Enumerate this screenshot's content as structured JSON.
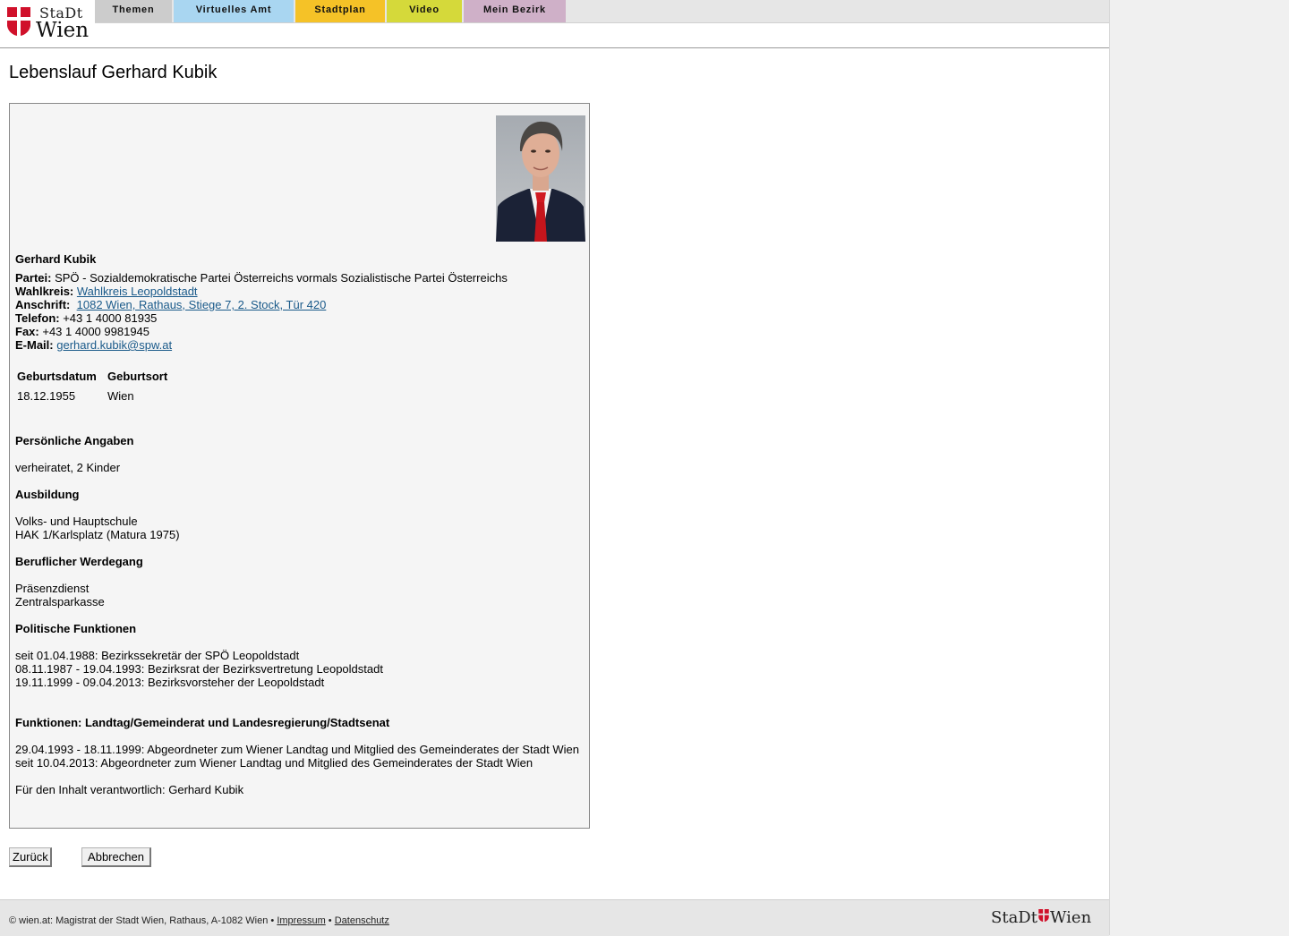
{
  "header": {
    "logo_line1": "StaDt",
    "logo_line2": "Wien",
    "nav": [
      {
        "label": "Themen",
        "color": "#cccccc"
      },
      {
        "label": "Virtuelles Amt",
        "color": "#a9d6f1"
      },
      {
        "label": "Stadtplan",
        "color": "#f5c227"
      },
      {
        "label": "Video",
        "color": "#d5d93a"
      },
      {
        "label": "Mein Bezirk",
        "color": "#cfb0c8"
      }
    ]
  },
  "page": {
    "title": "Lebenslauf Gerhard Kubik"
  },
  "profile": {
    "name": "Gerhard Kubik",
    "party_label": "Partei:",
    "party": "SPÖ - Sozialdemokratische Partei Österreichs vormals Sozialistische Partei Österreichs",
    "district_label": "Wahlkreis:",
    "district": "Wahlkreis Leopoldstadt",
    "address_label": "Anschrift:",
    "address": "1082 Wien, Rathaus, Stiege 7, 2. Stock, Tür 420",
    "phone_label": "Telefon:",
    "phone": "+43 1 4000 81935",
    "fax_label": "Fax:",
    "fax": "+43 1 4000 9981945",
    "email_label": "E-Mail:",
    "email": "gerhard.kubik@spw.at"
  },
  "birth_table": {
    "headers": [
      "Geburtsdatum",
      "Geburtsort"
    ],
    "values": [
      "18.12.1955",
      "Wien"
    ]
  },
  "sections": {
    "personal": {
      "title": "Persönliche Angaben",
      "lines": [
        "verheiratet, 2 Kinder"
      ]
    },
    "education": {
      "title": "Ausbildung",
      "lines": [
        "Volks- und Hauptschule",
        "HAK 1/Karlsplatz (Matura 1975)"
      ]
    },
    "career": {
      "title": "Beruflicher Werdegang",
      "lines": [
        "Präsenzdienst",
        "Zentralsparkasse"
      ]
    },
    "political": {
      "title": "Politische Funktionen",
      "lines": [
        "seit 01.04.1988: Bezirkssekretär der SPÖ Leopoldstadt",
        "08.11.1987 - 19.04.1993: Bezirksrat der Bezirksvertretung Leopoldstadt",
        "19.11.1999 - 09.04.2013: Bezirksvorsteher der Leopoldstadt"
      ]
    },
    "functions": {
      "title": "Funktionen: Landtag/Gemeinderat und Landesregierung/Stadtsenat",
      "lines": [
        "29.04.1993 - 18.11.1999: Abgeordneter zum Wiener Landtag und Mitglied des Gemeinderates der Stadt Wien",
        "seit 10.04.2013: Abgeordneter zum Wiener Landtag und Mitglied des Gemeinderates der Stadt Wien"
      ]
    }
  },
  "responsible": "Für den Inhalt verantwortlich: Gerhard Kubik",
  "buttons": {
    "back": "Zurück",
    "cancel": "Abbrechen"
  },
  "footer": {
    "text": "© wien.at: Magistrat der Stadt Wien, Rathaus, A-1082 Wien •",
    "imprint": "Impressum",
    "sep": "•",
    "privacy": "Datenschutz",
    "logo_left": "StaDt",
    "logo_right": "Wien"
  },
  "colors": {
    "link": "#1a5a8a",
    "shield_red": "#d0112b"
  }
}
